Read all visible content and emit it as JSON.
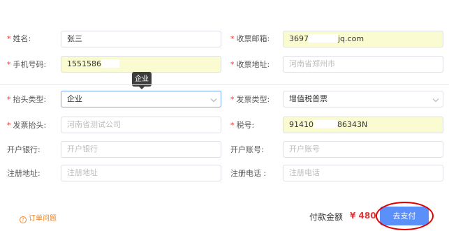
{
  "form": {
    "name_label": "姓名:",
    "name_value": "张三",
    "email_label": "收票邮箱:",
    "email_value_prefix": "3697",
    "email_value_suffix": "jq.com",
    "phone_label": "手机号码:",
    "phone_value_prefix": "1551586",
    "address_label": "收票地址:",
    "address_placeholder": "河南省郑州市",
    "title_type_label": "抬头类型:",
    "title_type_value": "企业",
    "invoice_type_label": "发票类型:",
    "invoice_type_value": "增值税普票",
    "invoice_title_label": "发票抬头:",
    "invoice_title_placeholder": "河南省测试公司",
    "tax_no_label": "税号:",
    "tax_no_prefix": "91410",
    "tax_no_suffix": "86343N",
    "bank_label": "开户银行:",
    "bank_placeholder": "开户银行",
    "account_label": "开户账号:",
    "account_placeholder": "开户账号",
    "reg_address_label": "注册地址:",
    "reg_address_placeholder": "注册地址",
    "reg_phone_label": "注册电话 :",
    "reg_phone_placeholder": "注册电话"
  },
  "tooltip": {
    "text": "企业"
  },
  "footer": {
    "faq_icon": "?",
    "faq_link": "订单问题",
    "total_label": "付款金额",
    "total_amount": "¥ 480",
    "pay_button": "去支付"
  },
  "colors": {
    "required": "#e4393c",
    "accent": "#5b8ff9",
    "filled_bg": "#fafbd0",
    "highlight": "#e00000",
    "link": "#f0852a"
  },
  "icons": {
    "select_arrow": "chevron-down-icon",
    "faq": "question-circle-icon"
  }
}
